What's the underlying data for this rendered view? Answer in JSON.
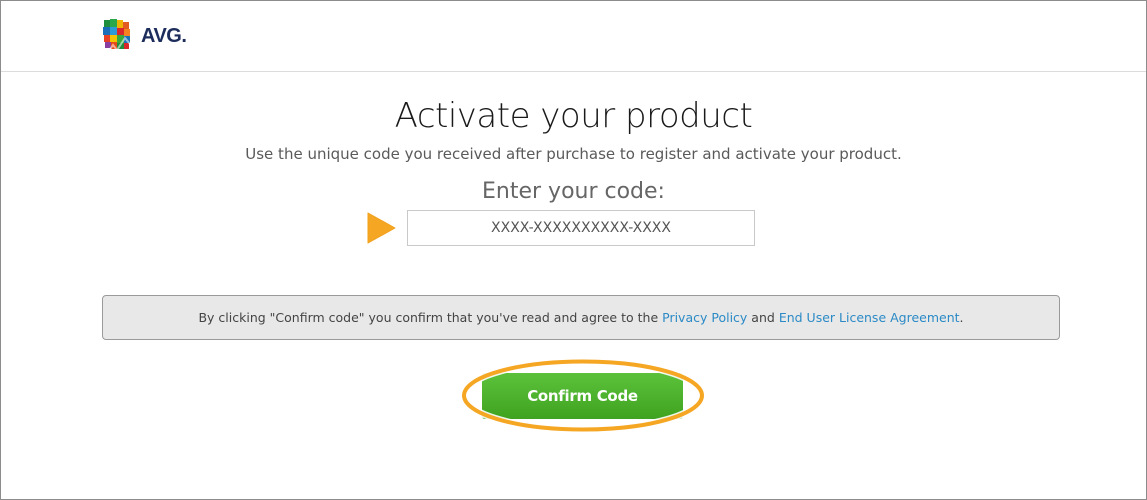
{
  "header": {
    "logo_text": "AVG."
  },
  "main": {
    "title": "Activate your product",
    "subtitle": "Use the unique code you received after purchase to register and activate your product.",
    "code_label": "Enter your code:",
    "code_input": {
      "placeholder": "XXXX-XXXXXXXXXX-XXXX",
      "value": ""
    },
    "notice": {
      "prefix": "By clicking \"Confirm code\" you confirm that you've read and agree to the",
      "privacy_link": "Privacy Policy",
      "middle": "and",
      "eula_link": "End User License Agreement",
      "suffix": "."
    },
    "confirm_button_label": "Confirm Code"
  },
  "colors": {
    "brand_green": "#4bb22c",
    "highlight_orange": "#f5a623",
    "link_blue": "#2b8ac6",
    "logo_navy": "#1c2c5b"
  },
  "icons": {
    "logo_mark": "avg-logo-icon",
    "pointer": "arrow-right-icon"
  }
}
